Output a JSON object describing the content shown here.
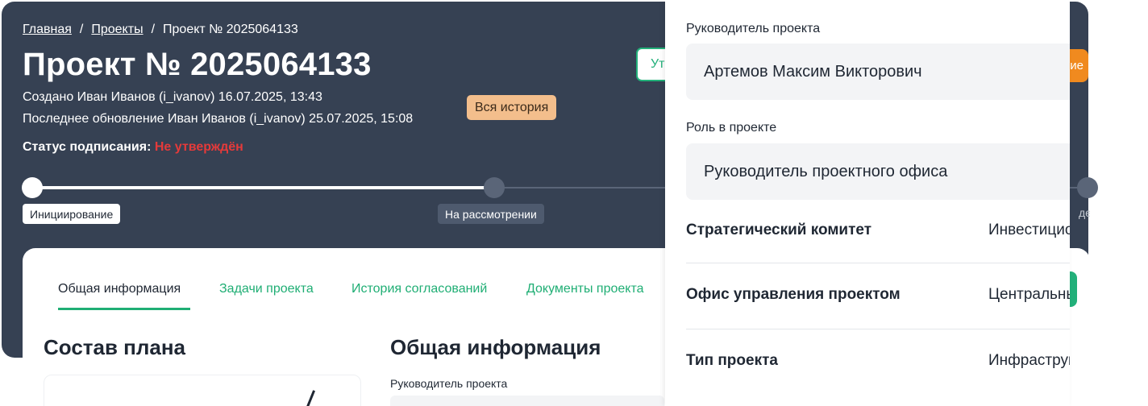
{
  "breadcrumb": {
    "home": "Главная",
    "projects": "Проекты",
    "current": "Проект № 2025064133",
    "separator": "/"
  },
  "header": {
    "title": "Проект № 2025064133",
    "created": "Создано Иван Иванов (i_ivanov) 16.07.2025, 13:43",
    "updated": "Последнее обновление Иван Иванов (i_ivanov) 25.07.2025, 15:08",
    "status_label": "Статус подписания:",
    "status_value": "Не утверждён",
    "history_button": "Вся история",
    "approve_button_partial": "Ут",
    "orange_button_partial": "ие"
  },
  "stages": {
    "items": [
      {
        "label": "Инициирование",
        "state": "done"
      },
      {
        "label": "На рассмотрении",
        "state": "current"
      },
      {
        "label": "ден",
        "state": "todo"
      }
    ]
  },
  "tabs": [
    {
      "label": "Общая информация",
      "active": true
    },
    {
      "label": "Задачи проекта",
      "active": false
    },
    {
      "label": "История согласований",
      "active": false
    },
    {
      "label": "Документы проекта",
      "active": false
    }
  ],
  "sections": {
    "plan_title": "Состав плана",
    "info_title": "Общая информация",
    "info_first_label": "Руководитель проекта"
  },
  "panel": {
    "manager_label": "Руководитель проекта",
    "manager_value": "Артемов Максим Викторович",
    "role_label": "Роль в проекте",
    "role_value": "Руководитель проектного офиса",
    "rows": [
      {
        "label": "Стратегический комитет",
        "value": "Инвестиционный"
      },
      {
        "label": "Офис управления проектом",
        "value": "Центральный"
      },
      {
        "label": "Тип проекта",
        "value": "Инфраструктурный"
      }
    ]
  },
  "colors": {
    "header_bg": "#364153",
    "accent_green": "#1fae74",
    "status_red": "#e53a3a",
    "history_orange": "#f3be8c",
    "action_orange": "#f08a1f"
  }
}
